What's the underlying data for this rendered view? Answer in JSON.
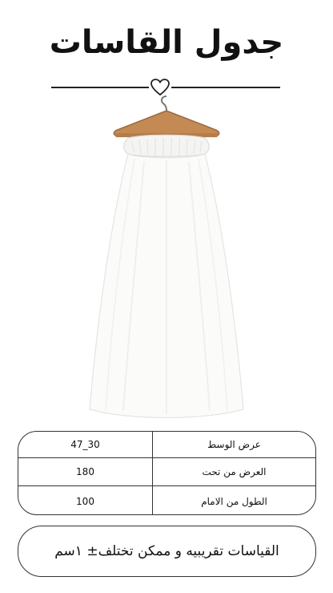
{
  "header": {
    "title": "جدول القاسات"
  },
  "decor": {
    "divider_icon": "heart-icon"
  },
  "image": {
    "subject": "white-skirt-on-hanger"
  },
  "size_table": {
    "rows": [
      {
        "label": "عرض الوسط",
        "value": "47_30"
      },
      {
        "label": "العرض من تحت",
        "value": "180"
      },
      {
        "label": "الطول من الامام",
        "value": "100"
      }
    ]
  },
  "note": {
    "text": "القياسات تقريبيه و ممكن تختلف± ١سم"
  }
}
